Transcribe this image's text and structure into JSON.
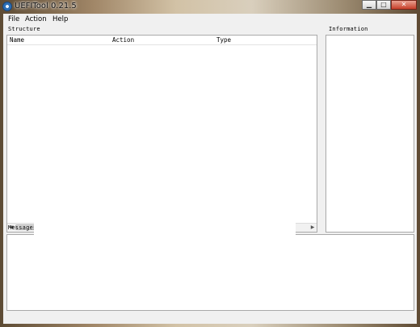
{
  "window": {
    "title": "UEFITool 0.21.5",
    "controls": {
      "minimize": "▁",
      "maximize": "□",
      "close": "✕"
    }
  },
  "menu": {
    "items": [
      "File",
      "Action",
      "Help"
    ]
  },
  "structure": {
    "label": "Structure",
    "columns": [
      "Name",
      "Action",
      "Type"
    ],
    "scroll_left": "◀",
    "scroll_right": "▶"
  },
  "information": {
    "label": "Information"
  },
  "messages": {
    "label": "Messages"
  }
}
